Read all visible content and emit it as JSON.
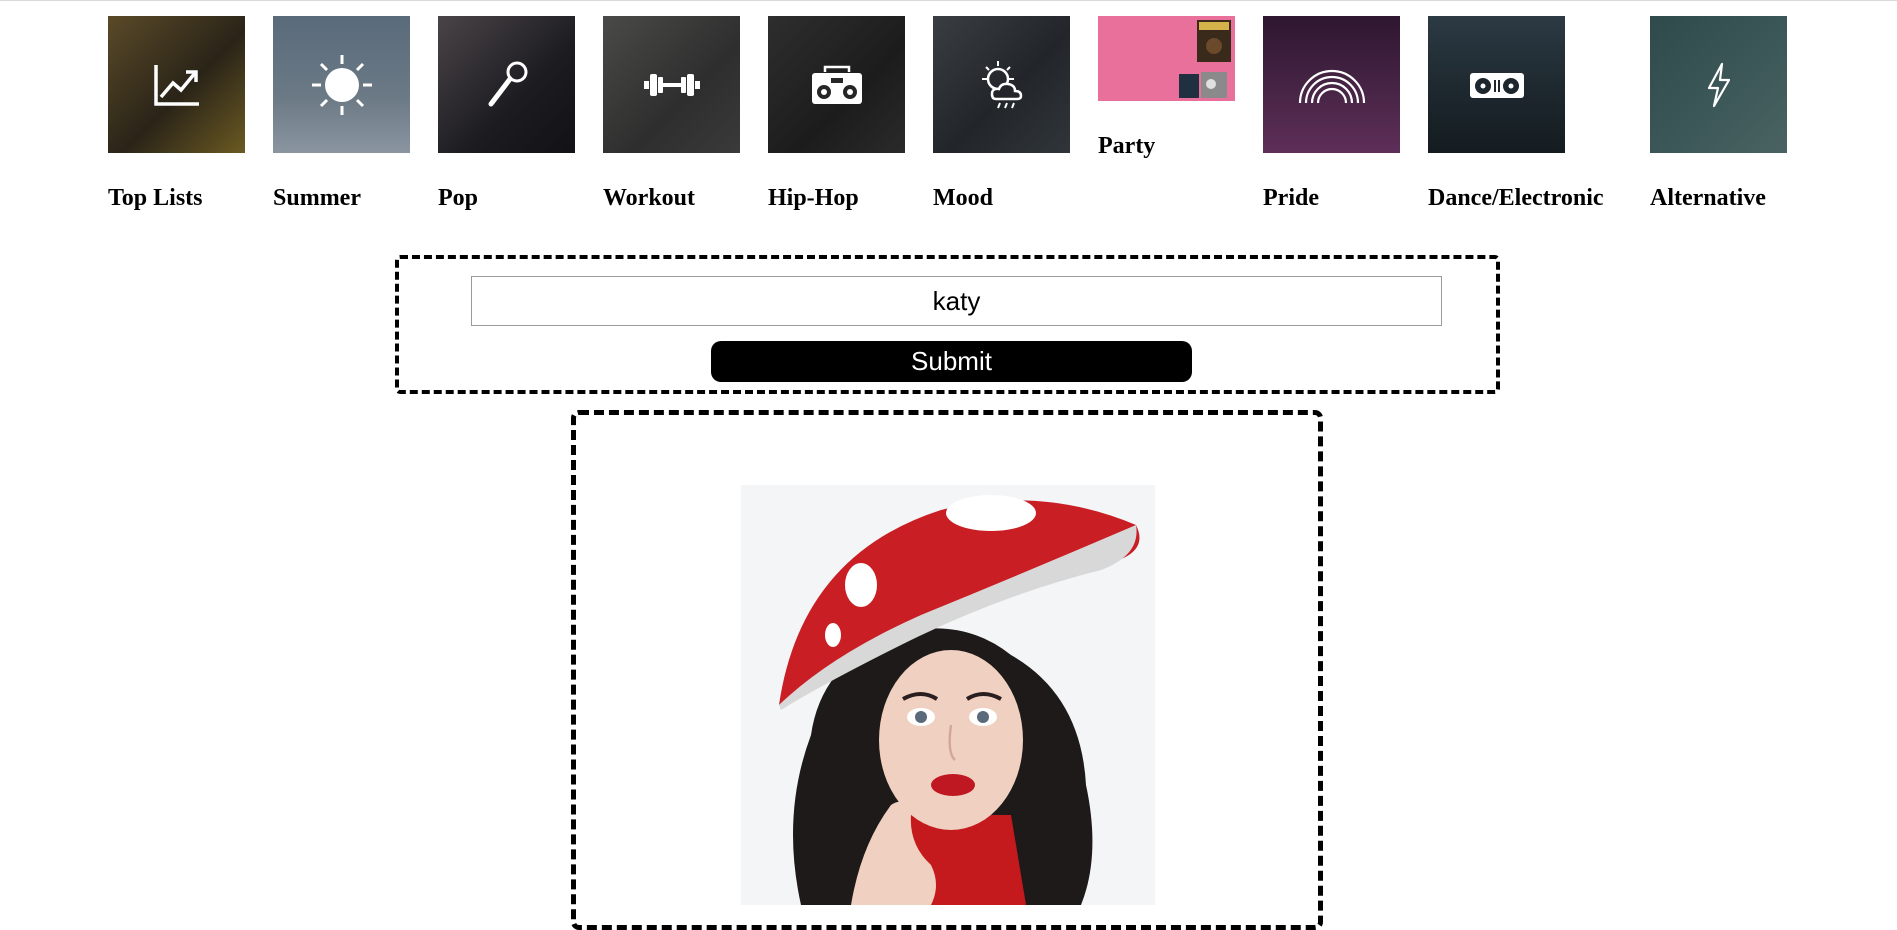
{
  "categories": [
    {
      "label": "Top Lists",
      "icon": "trending-up-icon",
      "bg": "#3a3320"
    },
    {
      "label": "Summer",
      "icon": "sun-icon",
      "bg": "#4f5b68"
    },
    {
      "label": "Pop",
      "icon": "microphone-icon",
      "bg": "#2a2a2e"
    },
    {
      "label": "Workout",
      "icon": "dumbbell-icon",
      "bg": "#3a3a3a"
    },
    {
      "label": "Hip-Hop",
      "icon": "boombox-icon",
      "bg": "#262626"
    },
    {
      "label": "Mood",
      "icon": "weather-mood-icon",
      "bg": "#2c3034"
    },
    {
      "label": "Party",
      "icon": "party-album-icon",
      "bg": "#e8709a"
    },
    {
      "label": "Pride",
      "icon": "rainbow-icon",
      "bg": "#3e1f40"
    },
    {
      "label": "Dance/Electronic",
      "icon": "turntable-icon",
      "bg": "#223038"
    },
    {
      "label": "Alternative",
      "icon": "lightning-icon",
      "bg": "#35504f"
    }
  ],
  "search": {
    "value": "katy",
    "submit_label": "Submit"
  },
  "result": {
    "image": "artist-photo"
  }
}
